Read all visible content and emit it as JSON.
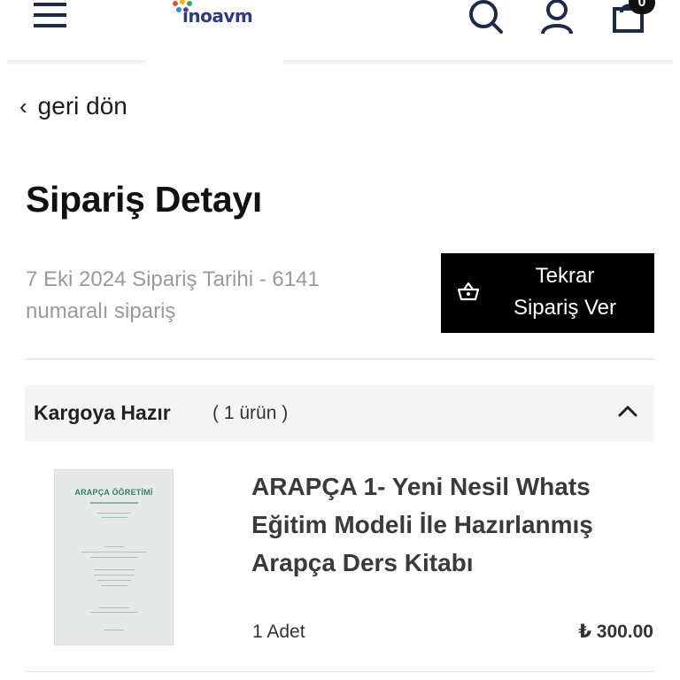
{
  "header": {
    "logo_text": "inoavm",
    "cart_count": "0"
  },
  "nav": {
    "back_label": "geri dön"
  },
  "page": {
    "title": "Sipariş Detayı"
  },
  "order": {
    "info": "7 Eki 2024 Sipariş Tarihi - 6141 numaralı sipariş",
    "reorder_label": "Tekrar Sipariş Ver"
  },
  "shipment": {
    "status": "Kargoya Hazır",
    "count": "( 1 ürün )"
  },
  "item": {
    "name": "ARAPÇA 1- Yeni Nesil Whats Eğitim Modeli İle Hazırlanmış Arapça Ders Kitabı",
    "quantity": "1 Adet",
    "price": "₺ 300.00",
    "cover_title": "ARAPÇA ÖĞRETİMİ"
  },
  "colors": {
    "button_bg": "#000000",
    "status_bg": "#f5f5f5",
    "muted_text": "#9a9a9a",
    "logo_blue": "#2a3a8c"
  },
  "icons": [
    "menu-icon",
    "search-icon",
    "user-icon",
    "cart-icon",
    "chevron-left-icon",
    "basket-icon",
    "chevron-up-icon"
  ]
}
